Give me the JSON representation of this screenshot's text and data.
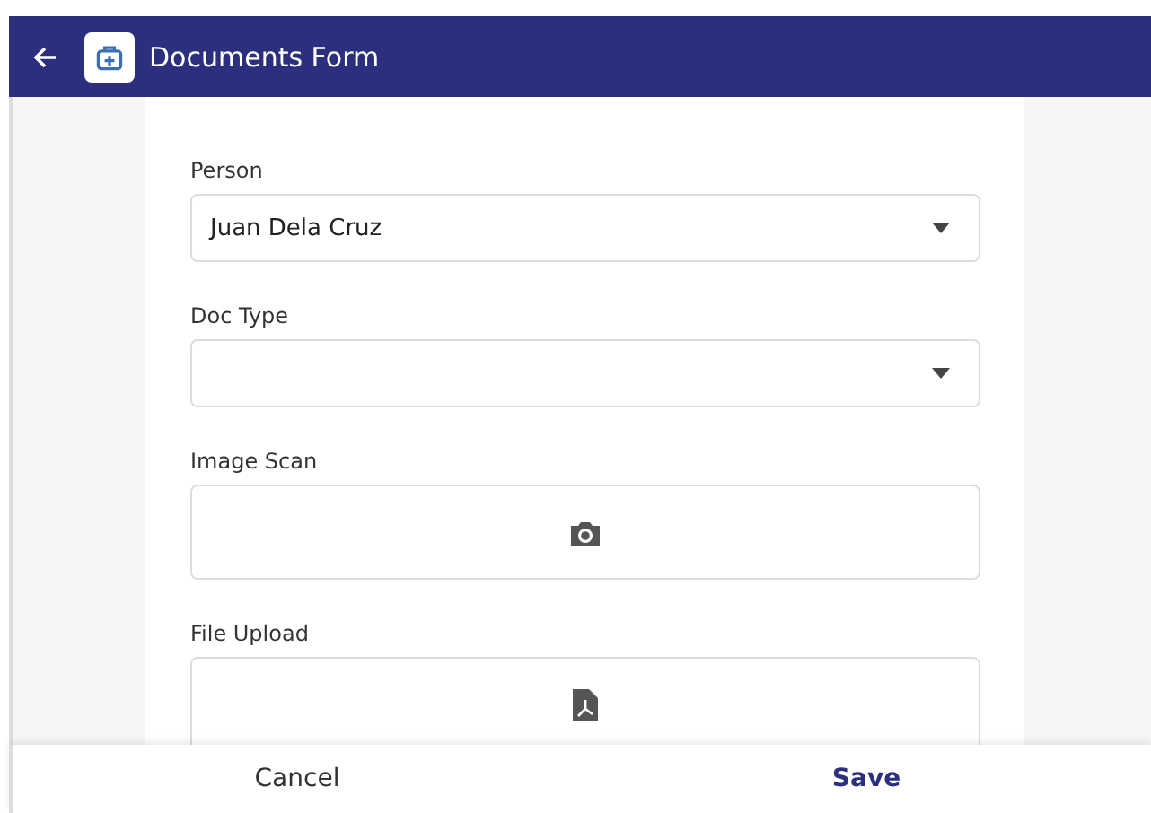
{
  "header": {
    "title": "Documents Form"
  },
  "fields": [
    {
      "kind": "select",
      "label": "Person",
      "value": "Juan Dela Cruz"
    },
    {
      "kind": "select",
      "label": "Doc Type"
    },
    {
      "kind": "camera",
      "label": "Image Scan"
    },
    {
      "kind": "pdf",
      "label": "File Upload"
    }
  ],
  "footer": {
    "buttons": [
      {
        "label": "Cancel",
        "kind": "secondary"
      },
      {
        "label": "Save",
        "kind": "primary"
      }
    ]
  }
}
